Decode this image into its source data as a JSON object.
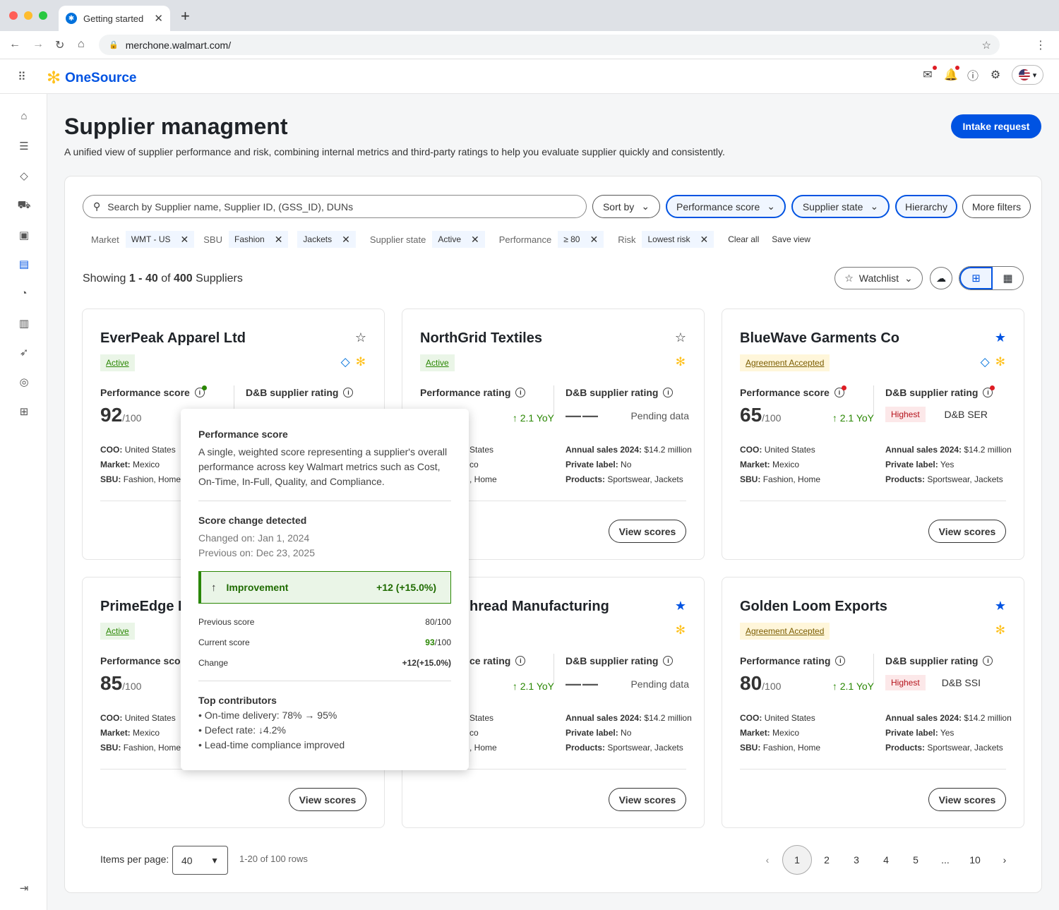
{
  "browser": {
    "tab_title": "Getting started",
    "url": "merchone.walmart.com/"
  },
  "app": {
    "name": "OneSource"
  },
  "page": {
    "title": "Supplier managment",
    "subtitle": "A unified view of supplier performance and risk, combining internal metrics and third-party ratings to help you evaluate supplier quickly and consistently.",
    "intake_label": "Intake request"
  },
  "filters": {
    "search_placeholder": "Search by Supplier name, Supplier ID, (GSS_ID), DUNs",
    "sort_by": "Sort by",
    "performance_score": "Performance score",
    "supplier_state": "Supplier state",
    "hierarchy": "Hierarchy",
    "more_filters": "More filters",
    "chips": {
      "market_label": "Market",
      "market_value": "WMT - US",
      "sbu_label": "SBU",
      "sbu_value1": "Fashion",
      "sbu_value2": "Jackets",
      "state_label": "Supplier state",
      "state_value": "Active",
      "perf_label": "Performance",
      "perf_value": "≥ 80",
      "risk_label": "Risk",
      "risk_value": "Lowest risk",
      "clear_all": "Clear all",
      "save_view": "Save view"
    }
  },
  "results": {
    "prefix": "Showing",
    "range": "1 - 40",
    "of": "of",
    "total": "400",
    "suffix": "Suppliers",
    "watchlist": "Watchlist"
  },
  "labels": {
    "den": "/100",
    "coo": "COO:",
    "market": "Market:",
    "sbu": "SBU:",
    "annual": "Annual sales 2024:",
    "private": "Private label:",
    "products": "Products:",
    "view_scores": "View scores",
    "dash": "——"
  },
  "cards": [
    {
      "name": "EverPeak Apparel Ltd",
      "status": "Active",
      "perf_label": "Performance score",
      "score": "92",
      "dnb_label": "D&B supplier rating",
      "coo": "United States",
      "market": "Mexico",
      "sbu": "Fashion, Home"
    },
    {
      "name": "NorthGrid Textiles",
      "status": "Active",
      "perf_label": "Performance rating",
      "yoy": "2.1 YoY",
      "dnb_label": "D&B supplier rating",
      "dnb_value": "Pending data",
      "coo_tail": "States",
      "market_tail": "co",
      "sbu_tail": ", Home",
      "annual": "$14.2 million",
      "private": "No",
      "products": "Sportswear, Jackets"
    },
    {
      "name": "BlueWave Garments Co",
      "status": "Agreement Accepted",
      "perf_label": "Performance score",
      "score": "65",
      "yoy": "2.1 YoY",
      "dnb_label": "D&B supplier rating",
      "risk": "Highest",
      "dnb_value": "D&B SER",
      "coo": "United States",
      "market": "Mexico",
      "sbu": "Fashion, Home",
      "annual": "$14.2 million",
      "private": "Yes",
      "products": "Sportswear, Jackets"
    },
    {
      "name": "PrimeEdge F",
      "status": "Active",
      "perf_label": "Performance scor",
      "score": "85",
      "coo": "United States",
      "market": "Mexico",
      "sbu": "Fashion, Home"
    },
    {
      "name": "hread Manufacturing",
      "perf_label": "ce rating",
      "yoy": "2.1 YoY",
      "dnb_label": "D&B supplier rating",
      "dnb_value": "Pending data",
      "coo_tail": "States",
      "market_tail": "co",
      "sbu_tail": ", Home",
      "annual": "$14.2 million",
      "private": "No",
      "products": "Sportswear, Jackets"
    },
    {
      "name": "Golden Loom Exports",
      "status": "Agreement Accepted",
      "perf_label": "Performance rating",
      "score": "80",
      "yoy": "2.1 YoY",
      "dnb_label": "D&B supplier rating",
      "risk": "Highest",
      "dnb_value": "D&B SSI",
      "coo": "United States",
      "market": "Mexico",
      "sbu": "Fashion, Home",
      "annual": "$14.2 million",
      "private": "Yes",
      "products": "Sportswear, Jackets"
    }
  ],
  "tooltip": {
    "title": "Performance score",
    "desc": "A single, weighted score representing a supplier's overall performance across key Walmart metrics such as Cost, On-Time, In-Full, Quality, and Compliance.",
    "change_title": "Score change detected",
    "changed_on": "Changed on: Jan 1, 2024",
    "previous_on": "Previous on: Dec 23, 2025",
    "improvement_label": "Improvement",
    "improvement_value": "+12 (+15.0%)",
    "prev_label": "Previous score",
    "prev_value": "80/100",
    "cur_label": "Current score",
    "cur_num": "93",
    "cur_den": "/100",
    "change_label": "Change",
    "change_value": "+12(+15.0%)",
    "contributors_title": "Top contributors",
    "c1": "• On-time delivery: 78% → 95%",
    "c2": "• Defect rate: ↓4.2%",
    "c3": "• Lead-time compliance improved"
  },
  "pagination": {
    "items_label": "Items per page:",
    "items_value": "40",
    "rows": "1-20 of 100 rows",
    "p1": "1",
    "p2": "2",
    "p3": "3",
    "p4": "4",
    "p5": "5",
    "ellipsis": "...",
    "p10": "10"
  }
}
